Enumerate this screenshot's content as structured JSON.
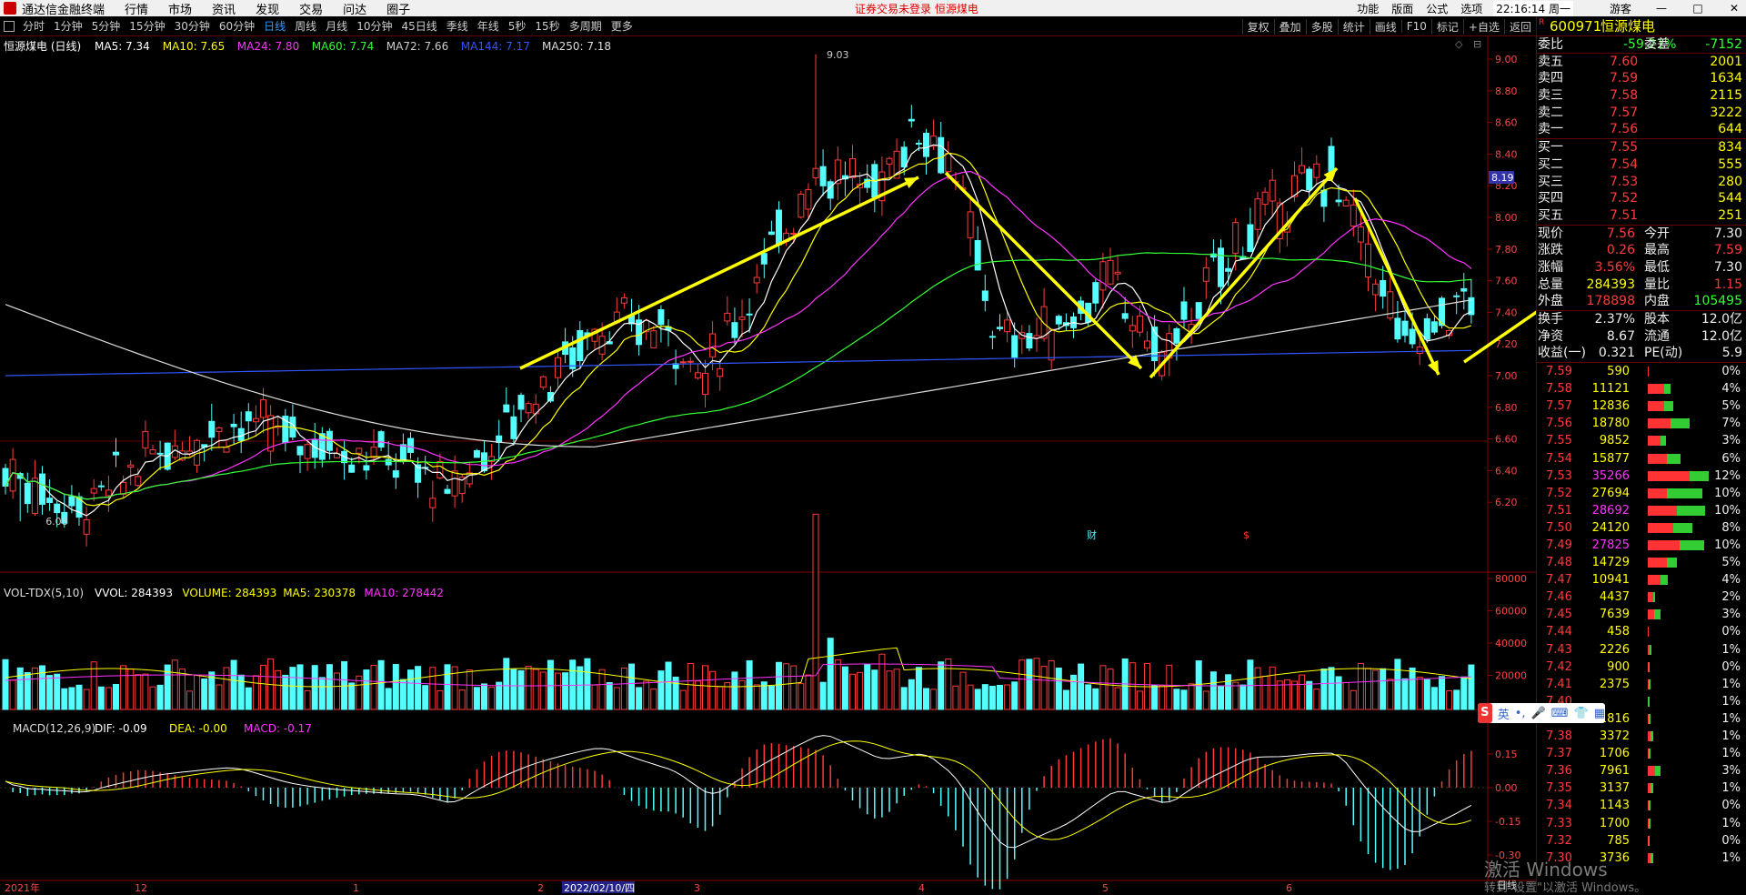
{
  "menu": {
    "app": "通达信金融终端",
    "items": [
      "行情",
      "市场",
      "资讯",
      "发现",
      "交易",
      "问达",
      "圈子"
    ],
    "warn": "证券交易未登录  恒源煤电",
    "right": [
      "功能",
      "版面",
      "公式",
      "选项"
    ],
    "time": "22:16:14 周一",
    "user": "游客"
  },
  "periods": [
    "分时",
    "1分钟",
    "5分钟",
    "15分钟",
    "30分钟",
    "60分钟",
    "日线",
    "周线",
    "月线",
    "10分钟",
    "45日线",
    "季线",
    "年线",
    "5秒",
    "15秒",
    "多周期",
    "更多"
  ],
  "period_active": "日线",
  "tools": [
    "复权",
    "叠加",
    "多股",
    "统计",
    "画线",
    "F10",
    "标记",
    "+自选",
    "返回"
  ],
  "main": {
    "title": "恒源煤电 (日线)",
    "ma": [
      {
        "t": "MA5: 7.34",
        "c": "#ffffff"
      },
      {
        "t": "MA10: 7.65",
        "c": "#ffff00"
      },
      {
        "t": "MA24: 7.80",
        "c": "#ff33ff"
      },
      {
        "t": "MA60: 7.74",
        "c": "#33ff33"
      },
      {
        "t": "MA72: 7.66",
        "c": "#cccccc"
      },
      {
        "t": "MA144: 7.17",
        "c": "#3355ff"
      },
      {
        "t": "MA250: 7.18",
        "c": "#dddddd"
      }
    ],
    "yticks": [
      "9.00",
      "8.80",
      "8.60",
      "8.40",
      "8.20",
      "8.00",
      "7.80",
      "7.60",
      "7.40",
      "7.20",
      "7.00",
      "6.80",
      "6.60",
      "6.40",
      "6.20"
    ],
    "high_label": "9.03",
    "low_label": "6.08",
    "cur_price": "8.19",
    "marks": [
      "财",
      "$"
    ]
  },
  "vol": {
    "title": "VOL-TDX(5,10)",
    "items": [
      {
        "t": "VVOL: 284393",
        "c": "#ffffff"
      },
      {
        "t": "VOLUME: 284393",
        "c": "#ffff00"
      },
      {
        "t": "MA5: 230378",
        "c": "#ffff00"
      },
      {
        "t": "MA10: 278442",
        "c": "#ff33ff"
      }
    ],
    "yticks": [
      "80000",
      "60000",
      "40000",
      "20000"
    ]
  },
  "macd": {
    "title": "MACD(12,26,9)",
    "items": [
      {
        "t": "DIF: -0.09",
        "c": "#ffffff"
      },
      {
        "t": "DEA: -0.00",
        "c": "#ffff00"
      },
      {
        "t": "MACD: -0.17",
        "c": "#ff33ff"
      }
    ],
    "yticks": [
      "0.15",
      "0.00",
      "-0.15",
      "-0.30"
    ]
  },
  "xaxis": {
    "labels": [
      {
        "t": "2021年",
        "x": 5
      },
      {
        "t": "12",
        "x": 148
      },
      {
        "t": "1",
        "x": 388
      },
      {
        "t": "2",
        "x": 591
      },
      {
        "t": "3",
        "x": 763
      },
      {
        "t": "4",
        "x": 1010
      },
      {
        "t": "5",
        "x": 1212
      },
      {
        "t": "6",
        "x": 1414
      }
    ],
    "cursor_date": "2022/02/10/四",
    "mode": "日线"
  },
  "quote": {
    "code": "600971",
    "name": "恒源煤电",
    "weibi_l": "委比",
    "weibi": "-59.21%",
    "weicha_l": "委差",
    "weicha": "-7152",
    "sells": [
      {
        "l": "卖五",
        "p": "7.60",
        "v": "2001"
      },
      {
        "l": "卖四",
        "p": "7.59",
        "v": "1634"
      },
      {
        "l": "卖三",
        "p": "7.58",
        "v": "2115"
      },
      {
        "l": "卖二",
        "p": "7.57",
        "v": "3222"
      },
      {
        "l": "卖一",
        "p": "7.56",
        "v": "644"
      }
    ],
    "buys": [
      {
        "l": "买一",
        "p": "7.55",
        "v": "834"
      },
      {
        "l": "买二",
        "p": "7.54",
        "v": "555"
      },
      {
        "l": "买三",
        "p": "7.53",
        "v": "280"
      },
      {
        "l": "买四",
        "p": "7.52",
        "v": "544"
      },
      {
        "l": "买五",
        "p": "7.51",
        "v": "251"
      }
    ],
    "stats": [
      {
        "a": "现价",
        "b": "7.56",
        "c": "今开",
        "d": "7.30",
        "bc": "#ff3a3a",
        "dc": "#eeeeee"
      },
      {
        "a": "涨跌",
        "b": "0.26",
        "c": "最高",
        "d": "7.59",
        "bc": "#ff3a3a",
        "dc": "#ff3a3a"
      },
      {
        "a": "涨幅",
        "b": "3.56%",
        "c": "最低",
        "d": "7.30",
        "bc": "#ff3a3a",
        "dc": "#eeeeee"
      },
      {
        "a": "总量",
        "b": "284393",
        "c": "量比",
        "d": "1.15",
        "bc": "#ffff00",
        "dc": "#ff3a3a"
      },
      {
        "a": "外盘",
        "b": "178898",
        "c": "内盘",
        "d": "105495",
        "bc": "#ff3a3a",
        "dc": "#33ff33"
      }
    ],
    "fin": [
      {
        "a": "换手",
        "b": "2.37%",
        "c": "股本",
        "d": "12.0亿"
      },
      {
        "a": "净资",
        "b": "8.67",
        "c": "流通",
        "d": "12.0亿"
      },
      {
        "a": "收益(一)",
        "b": "0.321",
        "c": "PE(动)",
        "d": "5.9"
      }
    ]
  },
  "depth": [
    {
      "p": "7.59",
      "v": "590",
      "pct": "0%",
      "vc": "#ffff00",
      "r": 0.02,
      "g": 0
    },
    {
      "p": "7.58",
      "v": "11121",
      "pct": "4%",
      "vc": "#ffff00",
      "r": 0.25,
      "g": 0.1
    },
    {
      "p": "7.57",
      "v": "12836",
      "pct": "5%",
      "vc": "#ffff00",
      "r": 0.25,
      "g": 0.15
    },
    {
      "p": "7.56",
      "v": "18780",
      "pct": "7%",
      "vc": "#ffff00",
      "r": 0.35,
      "g": 0.3
    },
    {
      "p": "7.55",
      "v": "9852",
      "pct": "3%",
      "vc": "#ffff00",
      "r": 0.2,
      "g": 0.08
    },
    {
      "p": "7.54",
      "v": "15877",
      "pct": "6%",
      "vc": "#ffff00",
      "r": 0.3,
      "g": 0.22
    },
    {
      "p": "7.53",
      "v": "35266",
      "pct": "12%",
      "vc": "#ff33ff",
      "r": 0.65,
      "g": 0.3
    },
    {
      "p": "7.52",
      "v": "27694",
      "pct": "10%",
      "vc": "#ffff00",
      "r": 0.3,
      "g": 0.55
    },
    {
      "p": "7.51",
      "v": "28692",
      "pct": "10%",
      "vc": "#ff33ff",
      "r": 0.45,
      "g": 0.45
    },
    {
      "p": "7.50",
      "v": "24120",
      "pct": "8%",
      "vc": "#ffff00",
      "r": 0.4,
      "g": 0.3
    },
    {
      "p": "7.49",
      "v": "27825",
      "pct": "10%",
      "vc": "#ff33ff",
      "r": 0.5,
      "g": 0.38
    },
    {
      "p": "7.48",
      "v": "14729",
      "pct": "5%",
      "vc": "#ffff00",
      "r": 0.3,
      "g": 0.15
    },
    {
      "p": "7.47",
      "v": "10941",
      "pct": "4%",
      "vc": "#ffff00",
      "r": 0.2,
      "g": 0.12
    },
    {
      "p": "7.46",
      "v": "4437",
      "pct": "2%",
      "vc": "#ffff00",
      "r": 0.08,
      "g": 0.04
    },
    {
      "p": "7.45",
      "v": "7639",
      "pct": "3%",
      "vc": "#ffff00",
      "r": 0.1,
      "g": 0.1
    },
    {
      "p": "7.44",
      "v": "458",
      "pct": "0%",
      "vc": "#ffff00",
      "r": 0.02,
      "g": 0
    },
    {
      "p": "7.43",
      "v": "2226",
      "pct": "1%",
      "vc": "#ffff00",
      "r": 0.03,
      "g": 0.03
    },
    {
      "p": "7.42",
      "v": "900",
      "pct": "0%",
      "vc": "#ffff00",
      "r": 0.02,
      "g": 0.01
    },
    {
      "p": "7.41",
      "v": "2375",
      "pct": "1%",
      "vc": "#ffff00",
      "r": 0.02,
      "g": 0.03
    },
    {
      "p": "7.40",
      "v": "",
      "pct": "1%",
      "vc": "#ffff00",
      "r": 0,
      "g": 0.03
    },
    {
      "p": "7.39",
      "v": "1816",
      "pct": "1%",
      "vc": "#ffff00",
      "r": 0.02,
      "g": 0.02
    },
    {
      "p": "7.38",
      "v": "3372",
      "pct": "1%",
      "vc": "#ffff00",
      "r": 0.04,
      "g": 0.04
    },
    {
      "p": "7.37",
      "v": "1706",
      "pct": "1%",
      "vc": "#ffff00",
      "r": 0.02,
      "g": 0.02
    },
    {
      "p": "7.36",
      "v": "7961",
      "pct": "3%",
      "vc": "#ffff00",
      "r": 0.12,
      "g": 0.08
    },
    {
      "p": "7.35",
      "v": "3137",
      "pct": "1%",
      "vc": "#ffff00",
      "r": 0.04,
      "g": 0.04
    },
    {
      "p": "7.34",
      "v": "1143",
      "pct": "0%",
      "vc": "#ffff00",
      "r": 0.02,
      "g": 0.02
    },
    {
      "p": "7.33",
      "v": "1700",
      "pct": "1%",
      "vc": "#ffff00",
      "r": 0.02,
      "g": 0.02
    },
    {
      "p": "7.32",
      "v": "785",
      "pct": "0%",
      "vc": "#ffff00",
      "r": 0.01,
      "g": 0.01
    },
    {
      "p": "7.30",
      "v": "3736",
      "pct": "1%",
      "vc": "#ffff00",
      "r": 0.04,
      "g": 0.05
    }
  ],
  "ime": {
    "label": "英"
  },
  "watermark": {
    "line1": "激活 Windows",
    "line2": "转到\"设置\"以激活 Windows。"
  }
}
